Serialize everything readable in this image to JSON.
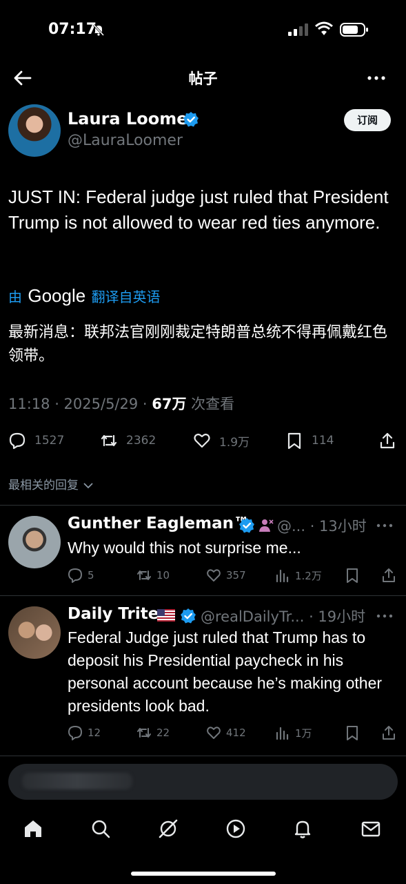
{
  "status_bar": {
    "time": "07:17"
  },
  "nav": {
    "title": "帖子"
  },
  "post": {
    "author_name": "Laura Loomer",
    "author_handle": "@LauraLoomer",
    "subscribe_label": "订阅",
    "text": "JUST IN: Federal judge just ruled that President Trump is not allowed to wear red ties anymore.",
    "translate_by": "由",
    "translate_brand": "Google",
    "translate_suffix": "翻译自英语",
    "translated_text": "最新消息：联邦法官刚刚裁定特朗普总统不得再佩戴红色领带。",
    "meta_time": "11:18 · 2025/5/29 · ",
    "meta_views_value": "67万",
    "meta_views_label": " 次查看",
    "actions": {
      "replies": "1527",
      "reposts": "2362",
      "likes": "1.9万",
      "bookmarks": "114"
    }
  },
  "replies_sort_label": "最相关的回复",
  "replies": [
    {
      "name": "Gunther Eagleman™",
      "handle_time": "@... · 13小时",
      "text": "Why would this not surprise me...",
      "replies": "5",
      "reposts": "10",
      "likes": "357",
      "views": "1.2万"
    },
    {
      "name": "Daily Trite",
      "handle_time": "@realDailyTr... · 19小时",
      "text": "Federal Judge just ruled that Trump has to deposit his Presidential paycheck in his personal account because he’s making other presidents look bad.",
      "replies": "12",
      "reposts": "22",
      "likes": "412",
      "views": "1万"
    }
  ],
  "colors": {
    "accent": "#1d9bf0",
    "muted": "#71767b",
    "background": "#000000"
  },
  "icons": [
    "back-arrow-icon",
    "more-icon",
    "verified-icon",
    "reply-icon",
    "repost-icon",
    "like-icon",
    "bookmark-icon",
    "share-icon",
    "views-icon",
    "home-icon",
    "search-icon",
    "grok-icon",
    "video-icon",
    "notifications-icon",
    "messages-icon"
  ]
}
